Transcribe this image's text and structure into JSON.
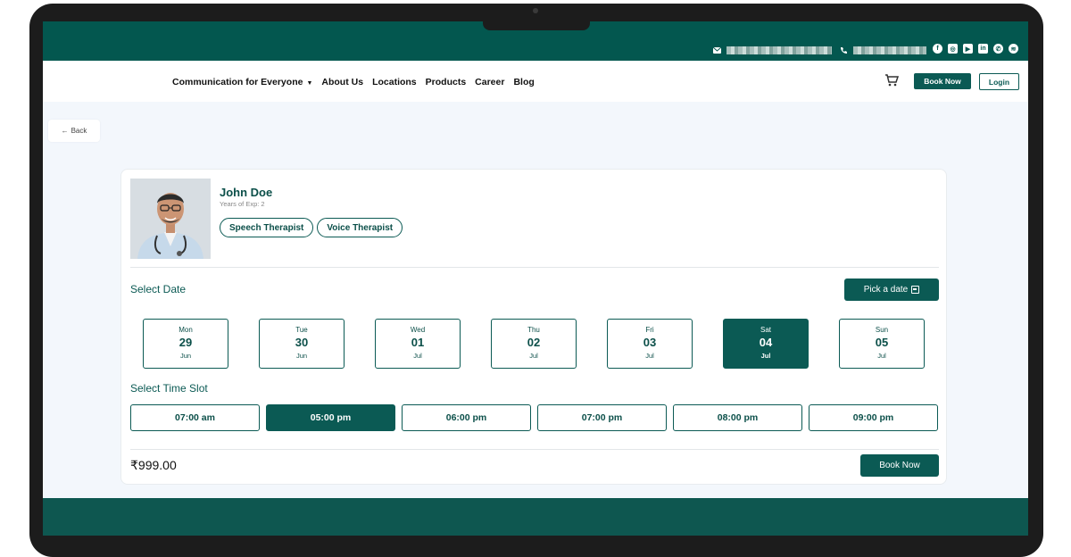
{
  "topbar": {
    "email_icon": "mail-icon",
    "phone_icon": "phone-icon",
    "social_icons": [
      "facebook-icon",
      "instagram-icon",
      "youtube-icon",
      "linkedin-icon",
      "whatsapp-icon",
      "spotify-icon"
    ]
  },
  "nav": {
    "items": [
      "Communication for Everyone",
      "About Us",
      "Locations",
      "Products",
      "Career",
      "Blog"
    ],
    "cart_icon": "cart-icon",
    "book_now": "Book Now",
    "login": "Login"
  },
  "back": {
    "label": "Back"
  },
  "therapist": {
    "name": "John Doe",
    "experience": "Years of Exp: 2",
    "tags": [
      "Speech Therapist",
      "Voice Therapist"
    ]
  },
  "select_date": {
    "title": "Select Date",
    "pick_label": "Pick a date",
    "dates": [
      {
        "day": "Mon",
        "date": "29",
        "month": "Jun",
        "selected": false
      },
      {
        "day": "Tue",
        "date": "30",
        "month": "Jun",
        "selected": false
      },
      {
        "day": "Wed",
        "date": "01",
        "month": "Jul",
        "selected": false
      },
      {
        "day": "Thu",
        "date": "02",
        "month": "Jul",
        "selected": false
      },
      {
        "day": "Fri",
        "date": "03",
        "month": "Jul",
        "selected": false
      },
      {
        "day": "Sat",
        "date": "04",
        "month": "Jul",
        "selected": true
      },
      {
        "day": "Sun",
        "date": "05",
        "month": "Jul",
        "selected": false
      }
    ]
  },
  "select_time": {
    "title": "Select Time Slot",
    "slots": [
      {
        "label": "07:00 am",
        "selected": false
      },
      {
        "label": "05:00 pm",
        "selected": true
      },
      {
        "label": "06:00 pm",
        "selected": false
      },
      {
        "label": "07:00 pm",
        "selected": false
      },
      {
        "label": "08:00 pm",
        "selected": false
      },
      {
        "label": "09:00 pm",
        "selected": false
      }
    ]
  },
  "booking": {
    "price": "₹999.00",
    "book_label": "Book Now"
  },
  "colors": {
    "brand": "#0b5a54",
    "topbar": "#03574f"
  }
}
